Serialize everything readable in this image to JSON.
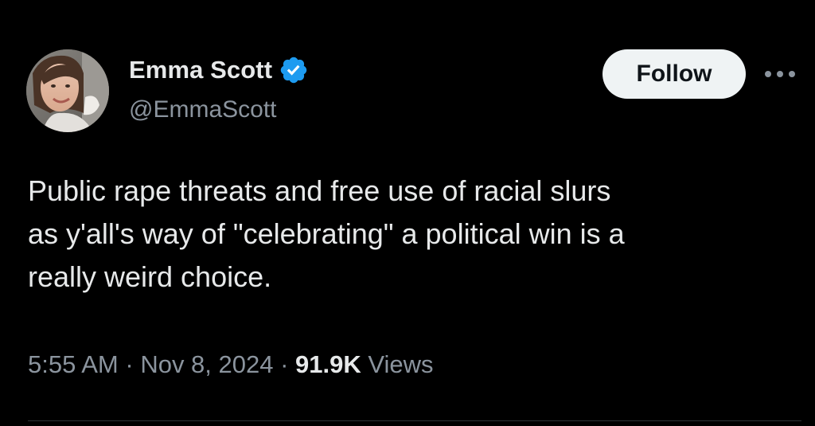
{
  "author": {
    "display_name": "Emma Scott",
    "handle": "@EmmaScott",
    "verified": true,
    "avatar": "profile-photo"
  },
  "actions": {
    "follow_label": "Follow",
    "more_icon": "more-horizontal-icon"
  },
  "tweet": {
    "text": "Public rape threats and free use of racial slurs\nas y'all's way of \"celebrating\" a political win is a\nreally weird choice."
  },
  "meta": {
    "time": "5:55 AM",
    "separator": " · ",
    "date": "Nov 8, 2024",
    "views_count": "91.9K",
    "views_label": " Views"
  },
  "colors": {
    "background": "#000000",
    "text_primary": "#e7e9ea",
    "text_secondary": "#8b949e",
    "verified_blue": "#1d9bf0",
    "follow_button_bg": "#eff3f4",
    "divider": "#2f3336"
  }
}
